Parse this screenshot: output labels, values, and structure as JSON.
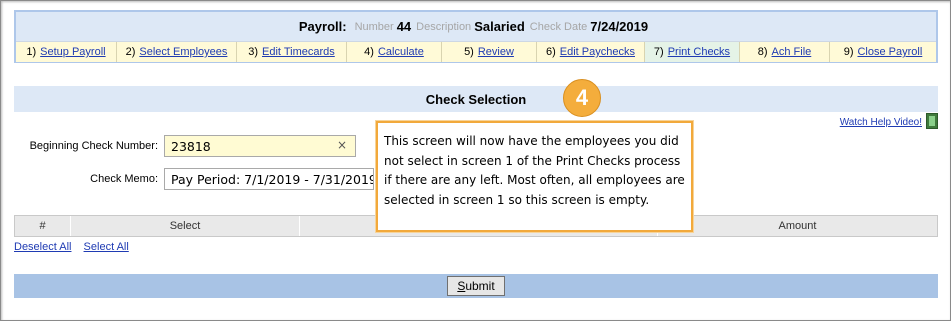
{
  "header": {
    "title": "Payroll:",
    "number_label": "Number",
    "number_value": "44",
    "description_label": "Description",
    "description_value": "Salaried",
    "check_date_label": "Check Date",
    "check_date_value": "7/24/2019"
  },
  "steps": [
    {
      "num": "1)",
      "label": "Setup Payroll",
      "active": false
    },
    {
      "num": "2)",
      "label": "Select Employees",
      "active": false
    },
    {
      "num": "3)",
      "label": "Edit Timecards",
      "active": false
    },
    {
      "num": "4)",
      "label": "Calculate",
      "active": false
    },
    {
      "num": "5)",
      "label": "Review",
      "active": false
    },
    {
      "num": "6)",
      "label": "Edit Paychecks",
      "active": false
    },
    {
      "num": "7)",
      "label": "Print Checks",
      "active": true
    },
    {
      "num": "8)",
      "label": "Ach File",
      "active": false
    },
    {
      "num": "9)",
      "label": "Close Payroll",
      "active": false
    }
  ],
  "check_selection": {
    "title": "Check Selection",
    "help_link": "Watch Help Video!",
    "help_icon": "film-icon",
    "beginning_check_label": "Beginning Check Number:",
    "beginning_check_value": "23818",
    "clear_glyph": "×",
    "check_memo_label": "Check Memo:",
    "check_memo_value": "Pay Period: 7/1/2019 - 7/31/2019"
  },
  "table": {
    "columns": [
      "#",
      "Select",
      "",
      "Amount"
    ]
  },
  "selection_links": {
    "deselect_all": "Deselect All",
    "select_all": "Select All"
  },
  "submit": {
    "accesskey_letter": "S",
    "label_rest": "ubmit"
  },
  "callout": {
    "badge": "4",
    "text": "This screen will now have the employees you did not select in screen 1 of the Print Checks process if there are any left. Most often, all employees are selected in screen 1 so this screen is empty."
  },
  "colors": {
    "header_bg": "#dde8f6",
    "step_bg": "#fffad7",
    "step_active_bg": "#e5f3e7",
    "link": "#1f3bb3",
    "callout_border": "#f2a93b",
    "submit_bar": "#a8c3e5"
  }
}
